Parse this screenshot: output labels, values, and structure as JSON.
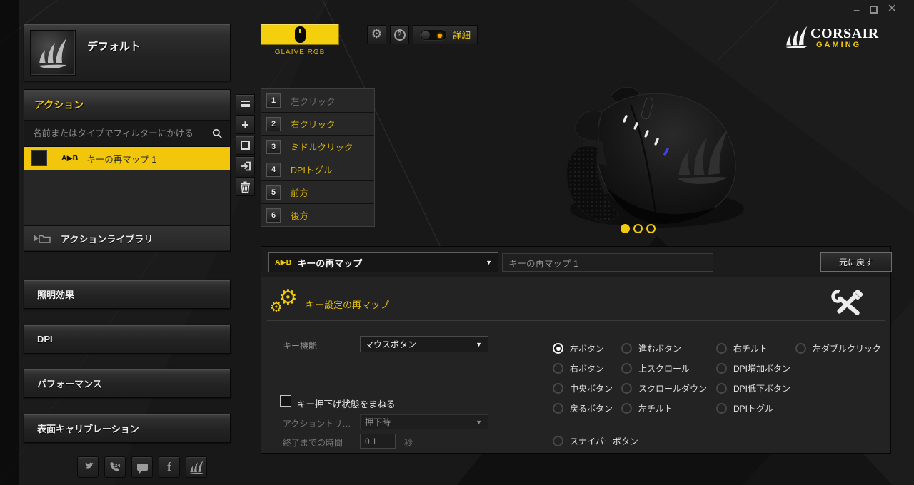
{
  "colors": {
    "accent": "#F2CC0A",
    "selection_yellow": "#F2C60A",
    "list_label_yellow": "#D7B50B",
    "dpi_indicator_blue": "#4242E8"
  },
  "window_controls": {
    "minimize": "–",
    "maximize": "□",
    "close": "✕"
  },
  "profile": {
    "name": "デフォルト"
  },
  "device": {
    "name": "GLAIVE RGB"
  },
  "topbar": {
    "advanced_label": "詳細"
  },
  "brand": {
    "title": "CORSAIR",
    "subtitle": "GAMING"
  },
  "actions_panel": {
    "title": "アクション",
    "filter_placeholder": "名前またはタイプでフィルターにかける",
    "selected_action": {
      "badge": "A▶B",
      "label": "キーの再マップ 1"
    },
    "library_label": "アクションライブラリ"
  },
  "nav_sections": [
    "照明効果",
    "DPI",
    "パフォーマンス",
    "表面キャリブレーション"
  ],
  "social_icons": [
    "twitter",
    "support-24",
    "chat",
    "facebook",
    "corsair-community"
  ],
  "toolbar_icons": [
    "menu",
    "add",
    "duplicate",
    "import",
    "delete"
  ],
  "button_assignments": [
    {
      "num": "1",
      "label": "左クリック"
    },
    {
      "num": "2",
      "label": "右クリック"
    },
    {
      "num": "3",
      "label": "ミドルクリック"
    },
    {
      "num": "4",
      "label": "DPIトグル"
    },
    {
      "num": "5",
      "label": "前方"
    },
    {
      "num": "6",
      "label": "後方"
    }
  ],
  "editor": {
    "type_dropdown": {
      "badge": "A▶B",
      "value": "キーの再マップ"
    },
    "name_value": "キーの再マップ 1",
    "undo_label": "元に戻す",
    "section_title": "キー設定の再マップ",
    "key_function_label": "キー機能",
    "key_function_value": "マウスボタン",
    "radio_buttons": [
      {
        "label": "左ボタン",
        "selected": true
      },
      {
        "label": "進むボタン"
      },
      {
        "label": "右チルト"
      },
      {
        "label": "左ダブルクリック"
      },
      {
        "label": "右ボタン"
      },
      {
        "label": "上スクロール"
      },
      {
        "label": "DPI増加ボタン"
      },
      {
        "label": "中央ボタン"
      },
      {
        "label": "スクロールダウン"
      },
      {
        "label": "DPI低下ボタン"
      },
      {
        "label": "戻るボタン"
      },
      {
        "label": "左チルト"
      },
      {
        "label": "DPIトグル"
      },
      {
        "label": "スナイパーボタン"
      }
    ],
    "mimic_checkbox_label": "キー押下げ状態をまねる",
    "trigger_label": "アクショントリ…",
    "trigger_value": "押下時",
    "duration_label": "終了までの時間",
    "duration_value": "0.1",
    "duration_unit": "秒"
  }
}
